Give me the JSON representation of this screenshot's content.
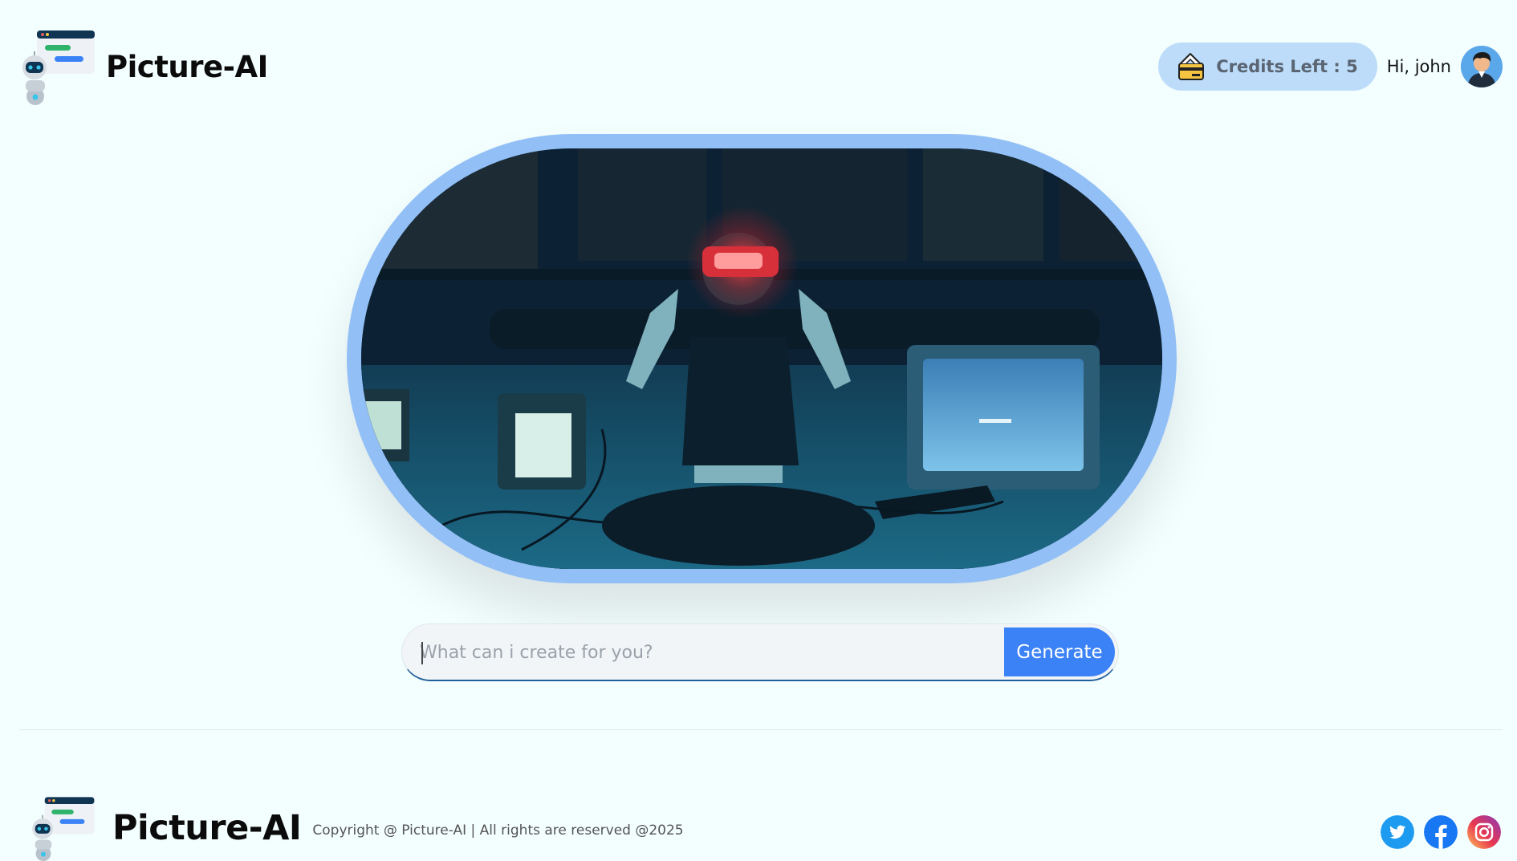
{
  "brand": {
    "name": "Picture-AI",
    "logo_icon": "robot-chat-icon"
  },
  "header": {
    "credits_label": "Credits Left : 5",
    "credits_icon": "credit-card-icon",
    "greeting": "Hi, john",
    "avatar_icon": "user-avatar"
  },
  "hero": {
    "image": "vr-headset-person-photo"
  },
  "prompt": {
    "placeholder": "What can i create for you?",
    "value": "",
    "button_label": "Generate"
  },
  "footer": {
    "brand": "Picture-AI",
    "copyright": "Copyright @ Picture-AI | All rights are reserved @2025",
    "socials": [
      "twitter-icon",
      "facebook-icon",
      "instagram-icon"
    ]
  },
  "colors": {
    "background": "#f3fefe",
    "accent": "#3b82f6",
    "credits_bg": "#bcdcf9",
    "hero_border": "#92bff6"
  }
}
